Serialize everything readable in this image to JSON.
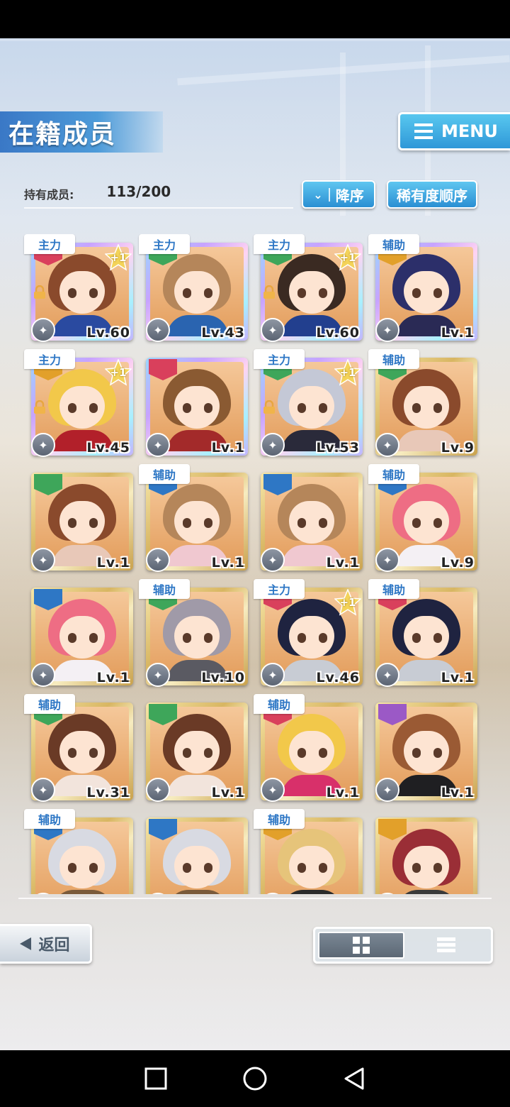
{
  "header": {
    "title": "在籍成员",
    "menu_label": "MENU"
  },
  "count": {
    "label": "持有成员:",
    "value": "113/200"
  },
  "sort": {
    "order_label": "降序",
    "rarity_label": "稀有度顺序"
  },
  "cards": [
    {
      "role": "主力",
      "level": "Lv.60",
      "frame": "rainbow",
      "attr": "#d9405c",
      "hair": "#8a4a2c",
      "body": "#2a4aa0",
      "locked": true,
      "plus": "+1"
    },
    {
      "role": "主力",
      "level": "Lv.43",
      "frame": "rainbow",
      "attr": "#3ea65a",
      "hair": "#b5865a",
      "body": "#2a64b0",
      "locked": false,
      "plus": ""
    },
    {
      "role": "主力",
      "level": "Lv.60",
      "frame": "rainbow",
      "attr": "#3ea65a",
      "hair": "#3a2a22",
      "body": "#223f8e",
      "locked": true,
      "plus": "+1"
    },
    {
      "role": "辅助",
      "level": "Lv.1",
      "frame": "rainbow",
      "attr": "#e2a02a",
      "hair": "#2c2f6a",
      "body": "#2a2a55",
      "locked": false,
      "plus": ""
    },
    {
      "role": "主力",
      "level": "Lv.45",
      "frame": "rainbow",
      "attr": "#e2a02a",
      "hair": "#f2c84a",
      "body": "#b2202a",
      "locked": true,
      "plus": "+1"
    },
    {
      "role": "",
      "level": "Lv.1",
      "frame": "rainbow",
      "attr": "#d9405c",
      "hair": "#8a5a32",
      "body": "#a32a2a",
      "locked": false,
      "plus": ""
    },
    {
      "role": "主力",
      "level": "Lv.53",
      "frame": "rainbow",
      "attr": "#3ea65a",
      "hair": "#c4c8d6",
      "body": "#2a2a3a",
      "locked": true,
      "plus": "+1"
    },
    {
      "role": "辅助",
      "level": "Lv.9",
      "frame": "gold",
      "attr": "#3ea65a",
      "hair": "#8a4a2c",
      "body": "#e8c8b8",
      "locked": false,
      "plus": ""
    },
    {
      "role": "",
      "level": "Lv.1",
      "frame": "gold",
      "attr": "#3ea65a",
      "hair": "#8a4a2c",
      "body": "#e8c8b8",
      "locked": false,
      "plus": ""
    },
    {
      "role": "辅助",
      "level": "Lv.1",
      "frame": "gold",
      "attr": "#2e77c5",
      "hair": "#b5865a",
      "body": "#f0c8d0",
      "locked": false,
      "plus": ""
    },
    {
      "role": "",
      "level": "Lv.1",
      "frame": "gold",
      "attr": "#2e77c5",
      "hair": "#b5865a",
      "body": "#f0c8d0",
      "locked": false,
      "plus": ""
    },
    {
      "role": "辅助",
      "level": "Lv.9",
      "frame": "gold",
      "attr": "#2e77c5",
      "hair": "#ee6d84",
      "body": "#f4f0f4",
      "locked": false,
      "plus": ""
    },
    {
      "role": "",
      "level": "Lv.1",
      "frame": "gold",
      "attr": "#2e77c5",
      "hair": "#ee6d84",
      "body": "#f4f0f4",
      "locked": false,
      "plus": ""
    },
    {
      "role": "辅助",
      "level": "Lv.10",
      "frame": "gold",
      "attr": "#3ea65a",
      "hair": "#a09aa8",
      "body": "#5a5a62",
      "locked": false,
      "plus": ""
    },
    {
      "role": "主力",
      "level": "Lv.46",
      "frame": "gold",
      "attr": "#d9405c",
      "hair": "#1f2340",
      "body": "#c8ccd4",
      "locked": false,
      "plus": "+1"
    },
    {
      "role": "辅助",
      "level": "Lv.1",
      "frame": "gold",
      "attr": "#d9405c",
      "hair": "#1f2340",
      "body": "#c8ccd4",
      "locked": false,
      "plus": ""
    },
    {
      "role": "辅助",
      "level": "Lv.31",
      "frame": "gold",
      "attr": "#3ea65a",
      "hair": "#6a3a26",
      "body": "#f2e4dc",
      "locked": false,
      "plus": ""
    },
    {
      "role": "",
      "level": "Lv.1",
      "frame": "gold",
      "attr": "#3ea65a",
      "hair": "#6a3a26",
      "body": "#f2e4dc",
      "locked": false,
      "plus": ""
    },
    {
      "role": "辅助",
      "level": "Lv.1",
      "frame": "gold",
      "attr": "#d9405c",
      "hair": "#f2c84a",
      "body": "#d8306a",
      "locked": false,
      "plus": ""
    },
    {
      "role": "",
      "level": "Lv.1",
      "frame": "gold",
      "attr": "#9b59c6",
      "hair": "#9a5a34",
      "body": "#1f1f22",
      "locked": false,
      "plus": ""
    },
    {
      "role": "辅助",
      "level": "",
      "frame": "gold",
      "attr": "#2e77c5",
      "hair": "#d8dae2",
      "body": "#7a5a3a",
      "locked": false,
      "plus": ""
    },
    {
      "role": "",
      "level": "",
      "frame": "gold",
      "attr": "#2e77c5",
      "hair": "#d8dae2",
      "body": "#7a5a3a",
      "locked": false,
      "plus": ""
    },
    {
      "role": "辅助",
      "level": "",
      "frame": "gold",
      "attr": "#e2a02a",
      "hair": "#e6c47a",
      "body": "#2a2a2a",
      "locked": false,
      "plus": ""
    },
    {
      "role": "",
      "level": "",
      "frame": "gold",
      "attr": "#e2a02a",
      "hair": "#9a2e36",
      "body": "#3a3a3a",
      "locked": false,
      "plus": ""
    }
  ],
  "footer": {
    "back_label": "返回"
  }
}
